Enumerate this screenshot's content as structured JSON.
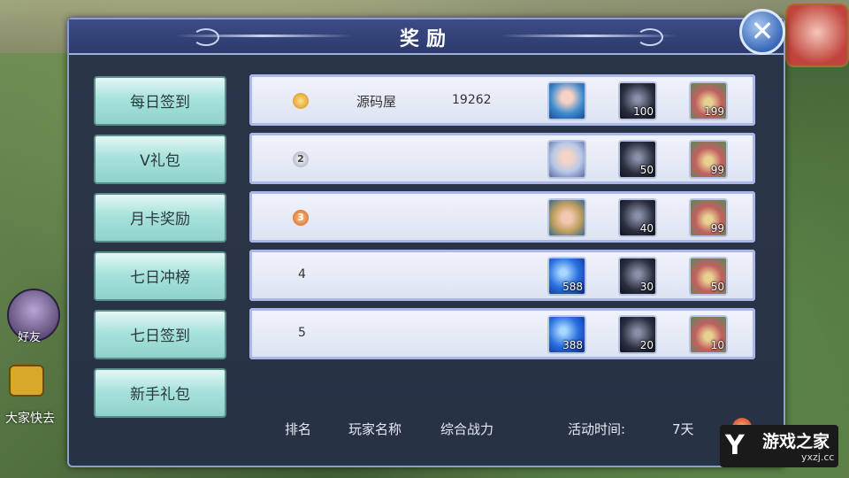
{
  "window": {
    "title": "奖励",
    "close_glyph": "✕"
  },
  "background": {
    "left_badge": "好友",
    "chat_text": "大家快去"
  },
  "tabs": [
    {
      "label": "每日签到"
    },
    {
      "label": "V礼包"
    },
    {
      "label": "月卡奖励"
    },
    {
      "label": "七日冲榜"
    },
    {
      "label": "七日签到"
    },
    {
      "label": "新手礼包"
    }
  ],
  "rows": [
    {
      "rank": "1",
      "rank_style": "gold-medal",
      "player": "源码屋",
      "power": "19262",
      "rewards": [
        {
          "icon": "blue-haired-hero-portrait-icon",
          "count": ""
        },
        {
          "icon": "dark-armor-icon",
          "count": "100"
        },
        {
          "icon": "treasure-bag-icon",
          "count": "199"
        }
      ]
    },
    {
      "rank": "2",
      "rank_style": "silver-medal",
      "player": "",
      "power": "",
      "rewards": [
        {
          "icon": "silver-haired-hero-portrait-icon",
          "count": ""
        },
        {
          "icon": "dark-armor-icon",
          "count": "50"
        },
        {
          "icon": "treasure-bag-icon",
          "count": "99"
        }
      ]
    },
    {
      "rank": "3",
      "rank_style": "bronze-medal",
      "player": "",
      "power": "",
      "rewards": [
        {
          "icon": "helmet-hero-portrait-icon",
          "count": ""
        },
        {
          "icon": "dark-armor-icon",
          "count": "40"
        },
        {
          "icon": "treasure-bag-icon",
          "count": "99"
        }
      ]
    },
    {
      "rank": "4",
      "rank_style": "plain",
      "player": "",
      "power": "",
      "rewards": [
        {
          "icon": "blue-gem-icon",
          "count": "588"
        },
        {
          "icon": "dark-armor-icon",
          "count": "30"
        },
        {
          "icon": "treasure-bag-icon",
          "count": "50"
        }
      ]
    },
    {
      "rank": "5",
      "rank_style": "plain",
      "player": "",
      "power": "",
      "rewards": [
        {
          "icon": "blue-gem-icon",
          "count": "388"
        },
        {
          "icon": "dark-armor-icon",
          "count": "20"
        },
        {
          "icon": "treasure-bag-icon",
          "count": "10"
        }
      ]
    }
  ],
  "footer": {
    "col_rank": "排名",
    "col_player": "玩家名称",
    "col_power": "综合战力",
    "activity_label": "活动时间:",
    "activity_value": "7天"
  },
  "watermark": {
    "logo": "Y",
    "name": "游戏之家",
    "url": "yxzj.cc"
  },
  "colors": {
    "tab_bg": "#a8e2dc",
    "row_bg": "#e6ebf7",
    "panel_bg": "#2b3548",
    "title_bar": "#3b4c86"
  }
}
